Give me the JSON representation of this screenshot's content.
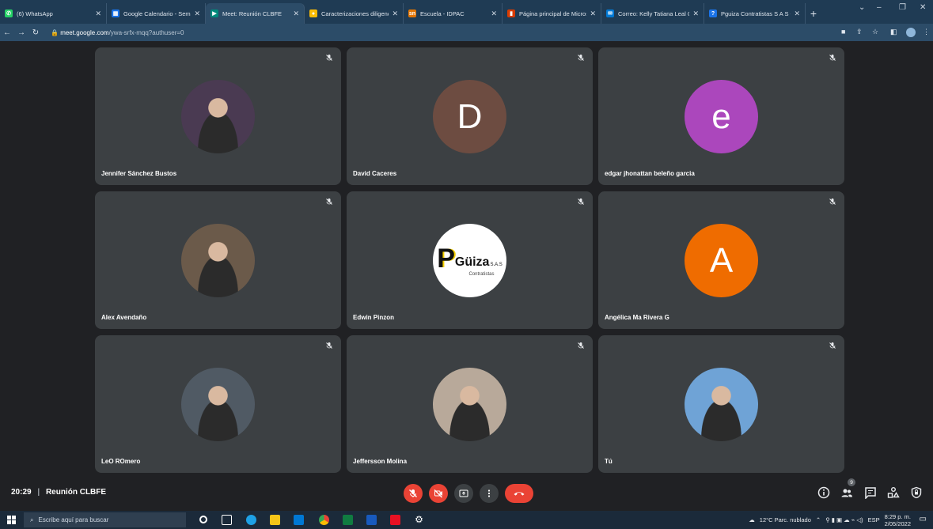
{
  "browser": {
    "tabs": [
      {
        "label": "(6) WhatsApp",
        "fav_color": "#25d366",
        "fav_glyph": "✆",
        "width": 135
      },
      {
        "label": "Google Calendario - Sema",
        "fav_color": "#1a73e8",
        "fav_glyph": "▦",
        "width": 125
      },
      {
        "label": "Meet: Reunión CLBFE",
        "fav_color": "#00897b",
        "fav_glyph": "▶",
        "width": 125,
        "active": true
      },
      {
        "label": "Caracterizaciones diligenci",
        "fav_color": "#fbbc04",
        "fav_glyph": "●",
        "width": 125
      },
      {
        "label": "Escuela - IDPAC",
        "fav_color": "#e37400",
        "fav_glyph": "sn",
        "width": 125
      },
      {
        "label": "Página principal de Micros",
        "fav_color": "#d83b01",
        "fav_glyph": "▮",
        "width": 125
      },
      {
        "label": "Correo: Kelly Tatiana Leal C",
        "fav_color": "#0078d4",
        "fav_glyph": "✉",
        "width": 130
      },
      {
        "label": "Pguiza Contratistas S A S -",
        "fav_color": "#1a73e8",
        "fav_glyph": "?",
        "width": 128
      }
    ],
    "new_tab": "+",
    "url_domain": "meet.google.com",
    "url_path": "/ywa-srfx-mqq?authuser=0"
  },
  "participants": [
    {
      "name": "Jennifer Sánchez Bustos",
      "avatar_type": "photo",
      "avatar_color": "#4a3a52"
    },
    {
      "name": "David Caceres",
      "avatar_type": "letter",
      "letter": "D",
      "avatar_color": "#6d4c41"
    },
    {
      "name": "edgar jhonattan beleño garcia",
      "avatar_type": "letter",
      "letter": "e",
      "avatar_color": "#ab47bc"
    },
    {
      "name": "Alex Avendaño",
      "avatar_type": "photo",
      "avatar_color": "#6b5a4a"
    },
    {
      "name": "Edwin Pinzon",
      "avatar_type": "logo",
      "logo_text": "Güiza",
      "logo_sub": "S.A.S",
      "logo_sub2": "Contratistas",
      "logo_letter": "P",
      "avatar_color": "#ffffff"
    },
    {
      "name": "Angélica Ma Rivera G",
      "avatar_type": "letter",
      "letter": "A",
      "avatar_color": "#ef6c00"
    },
    {
      "name": "LeO ROmero",
      "avatar_type": "photo",
      "avatar_color": "#505a64"
    },
    {
      "name": "Jeffersson Molina",
      "avatar_type": "photo",
      "avatar_color": "#b8a99a"
    },
    {
      "name": "Tú",
      "avatar_type": "photo",
      "avatar_color": "#6fa3d6"
    }
  ],
  "meeting": {
    "time": "20:29",
    "separator": "|",
    "title": "Reunión CLBFE",
    "people_count": "9"
  },
  "taskbar": {
    "search_placeholder": "Escribe aquí para buscar",
    "weather": "12°C  Parc. nublado",
    "lang": "ESP",
    "time": "8:29 p. m.",
    "date": "2/05/2022"
  }
}
